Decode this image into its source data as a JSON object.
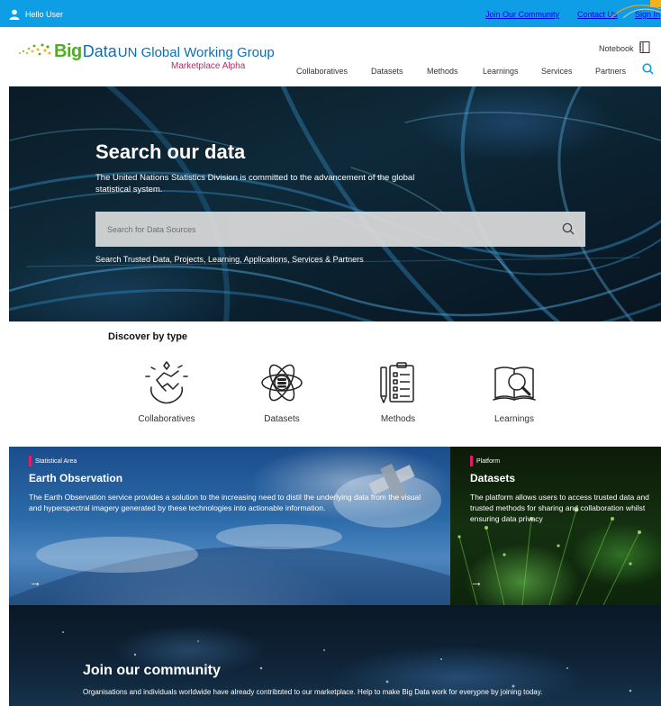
{
  "topbar": {
    "greeting": "Hello User",
    "join": "Join Our Community",
    "contact": "Contact Us",
    "signin": "Sign In"
  },
  "header": {
    "logo_big": "Big",
    "logo_data": "Data",
    "logo_un": "UN Global Working Group",
    "tagline": "Marketplace Alpha",
    "notebook": "Notebook",
    "nav": [
      "Collaboratives",
      "Datasets",
      "Methods",
      "Learnings",
      "Services",
      "Partners"
    ]
  },
  "hero": {
    "title": "Search our data",
    "description": "The United Nations Statistics Division is committed to the advancement of the global statistical system.",
    "search_placeholder": "Search for Data Sources",
    "subtitle": "Search Trusted Data, Projects, Learning, Applications, Services & Partners"
  },
  "discover": {
    "title": "Discover by type",
    "types": [
      {
        "label": "Collaboratives",
        "icon": "handshake-icon"
      },
      {
        "label": "Datasets",
        "icon": "atom-database-icon"
      },
      {
        "label": "Methods",
        "icon": "checklist-icon"
      },
      {
        "label": "Learnings",
        "icon": "book-magnifier-icon"
      }
    ]
  },
  "cards": {
    "earth": {
      "tag": "Statistical Area",
      "title": "Earth Observation",
      "description": "The Earth Observation service provides a solution to the increasing need to distil the underlying data from the visual and hyperspectral imagery generated by these technologies into actionable information.",
      "arrow": "→"
    },
    "datasets": {
      "tag": "Platform",
      "title": "Datasets",
      "description": "The platform allows users to access trusted data and trusted methods for sharing and collaboration whilst ensuring data privacy",
      "arrow": "→"
    }
  },
  "community": {
    "title": "Join our community",
    "description": "Organisations and individuals worldwide have already contributed to our marketplace. Help to make Big Data work for everyone by joining today."
  },
  "colors": {
    "topbar": "#0d9ee6",
    "logo_green": "#4caf22",
    "logo_blue": "#0d6eb8",
    "tagline": "#c0256b",
    "accent_pink": "#e31b6d"
  }
}
